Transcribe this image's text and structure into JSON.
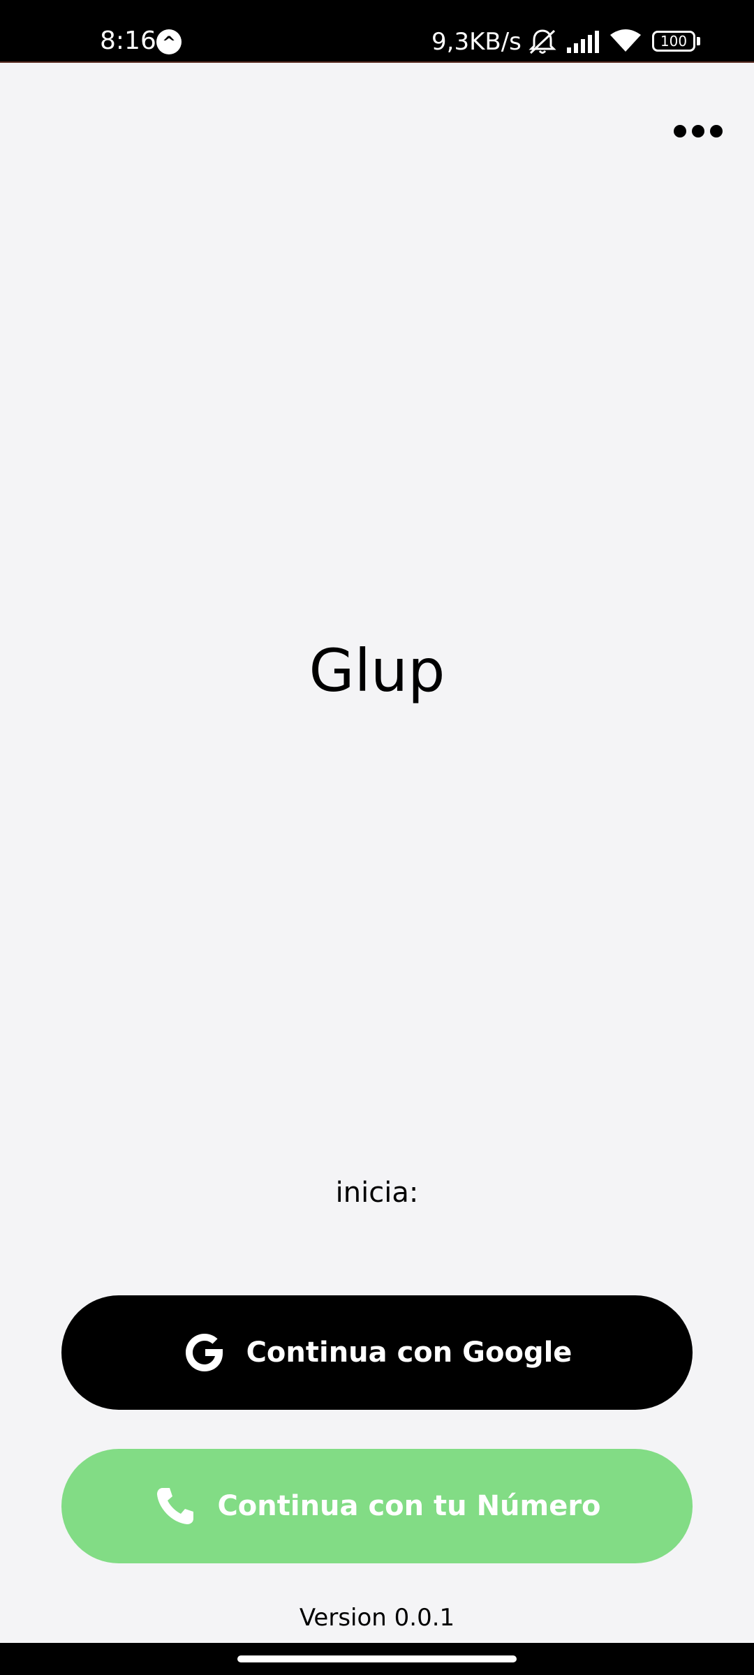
{
  "status_bar": {
    "time": "8:16",
    "notification_icon": "navigation-arrow-icon",
    "network_speed": "9,3KB/s",
    "icons": [
      "mute-bell-icon",
      "signal-icon",
      "wifi-icon"
    ],
    "battery_level": "100"
  },
  "header": {
    "menu_icon": "more-horizontal-icon"
  },
  "main": {
    "app_title": "Glup",
    "start_label": "inicia:"
  },
  "actions": {
    "google_label": "Continua con Google",
    "google_icon": "google-icon",
    "phone_label": "Continua con tu Número",
    "phone_icon": "phone-icon"
  },
  "footer": {
    "version": "Version 0.0.1"
  },
  "colors": {
    "background": "#f4f4f6",
    "google_button": "#000000",
    "phone_button": "#82dc85",
    "button_text": "#ffffff"
  }
}
